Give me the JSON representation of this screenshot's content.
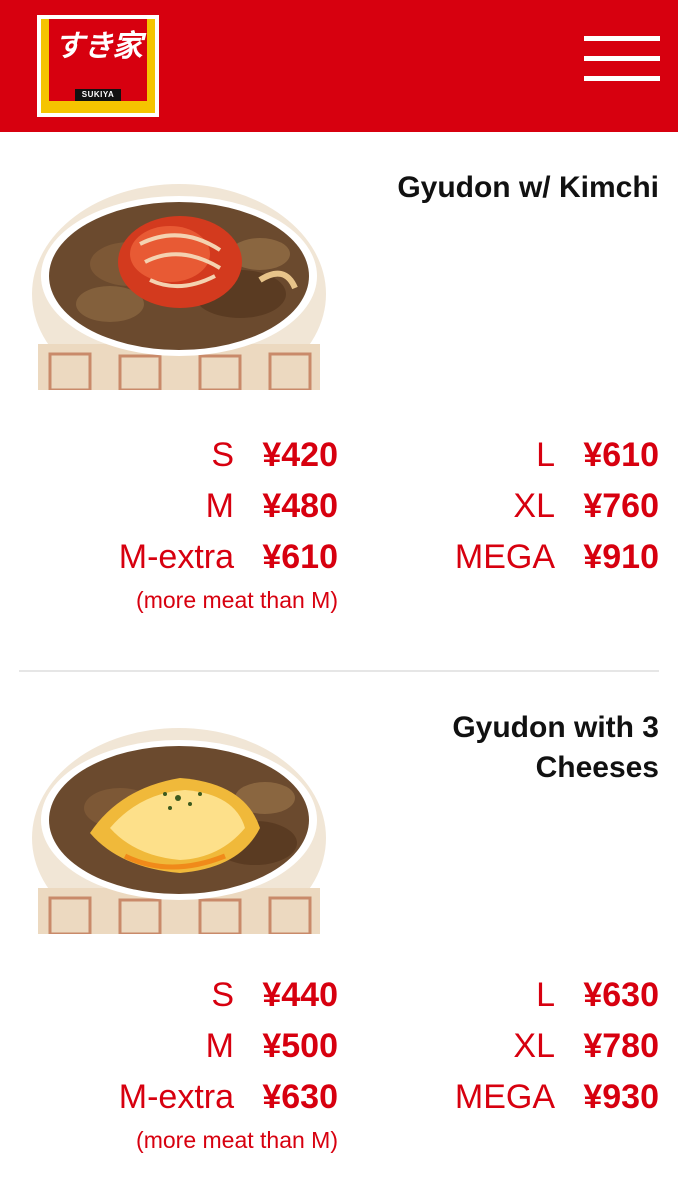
{
  "header": {
    "logo_mark": "すき家",
    "logo_text": "SUKIYA",
    "brand_color": "#d7000f",
    "logo_accent": "#f5c400",
    "menu_icon": "hamburger-menu-icon"
  },
  "items": [
    {
      "title": "Gyudon w/ Kimchi",
      "image": "gyudon-kimchi-bowl",
      "prices_left": [
        {
          "size": "S",
          "price": "¥420"
        },
        {
          "size": "M",
          "price": "¥480"
        },
        {
          "size": "M-extra",
          "price": "¥610"
        }
      ],
      "note": "(more meat than M)",
      "prices_right": [
        {
          "size": "L",
          "price": "¥610"
        },
        {
          "size": "XL",
          "price": "¥760"
        },
        {
          "size": "MEGA",
          "price": "¥910"
        }
      ]
    },
    {
      "title": "Gyudon with 3 Cheeses",
      "image": "gyudon-three-cheese-bowl",
      "prices_left": [
        {
          "size": "S",
          "price": "¥440"
        },
        {
          "size": "M",
          "price": "¥500"
        },
        {
          "size": "M-extra",
          "price": "¥630"
        }
      ],
      "note": "(more meat than M)",
      "prices_right": [
        {
          "size": "L",
          "price": "¥630"
        },
        {
          "size": "XL",
          "price": "¥780"
        },
        {
          "size": "MEGA",
          "price": "¥930"
        }
      ]
    }
  ]
}
